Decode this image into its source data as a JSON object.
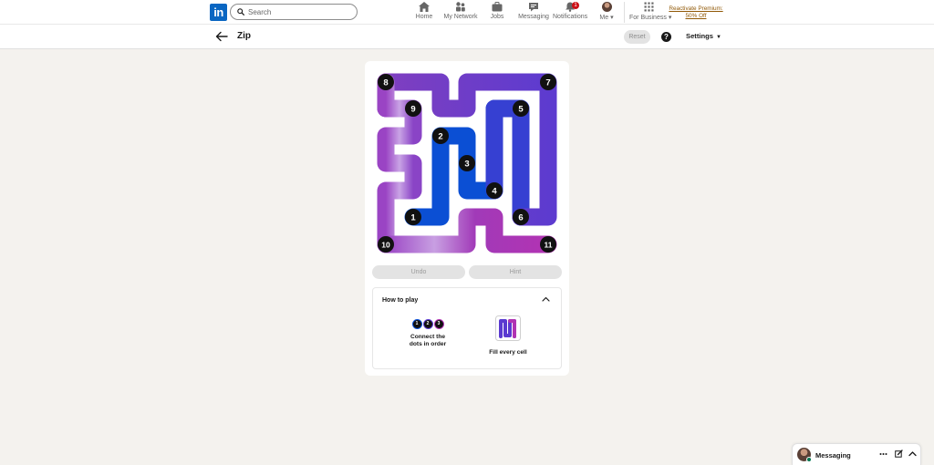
{
  "nav": {
    "logo_text": "in",
    "search_placeholder": "Search",
    "items": [
      {
        "label": "Home"
      },
      {
        "label": "My Network"
      },
      {
        "label": "Jobs"
      },
      {
        "label": "Messaging"
      },
      {
        "label": "Notifications",
        "badge": "1"
      },
      {
        "label": "Me"
      },
      {
        "label": "For Business"
      }
    ],
    "premium_line1": "Reactivate Premium:",
    "premium_line2": "50% Off"
  },
  "game": {
    "title": "Zip",
    "reset_label": "Reset",
    "help_label": "?",
    "settings_label": "Settings",
    "undo_label": "Undo",
    "hint_label": "Hint",
    "numbers": [
      "1",
      "2",
      "3",
      "4",
      "5",
      "6",
      "7",
      "8",
      "9",
      "10",
      "11"
    ],
    "how_to_play": {
      "title": "How to play",
      "step1_dots": [
        "1",
        "2",
        "3"
      ],
      "step1_line1": "Connect the",
      "step1_line2": "dots in order",
      "step2": "Fill every cell"
    },
    "colors": {
      "blue": "#0a4fd6",
      "indigo": "#4d39cc",
      "purple": "#7f3fc0",
      "magenta": "#b133b3",
      "dot": "#111111"
    }
  },
  "messaging": {
    "title": "Messaging"
  },
  "colors": {
    "accent": "#0a66c2",
    "premium": "#915907",
    "badge": "#cc1016",
    "online": "#01754f"
  }
}
